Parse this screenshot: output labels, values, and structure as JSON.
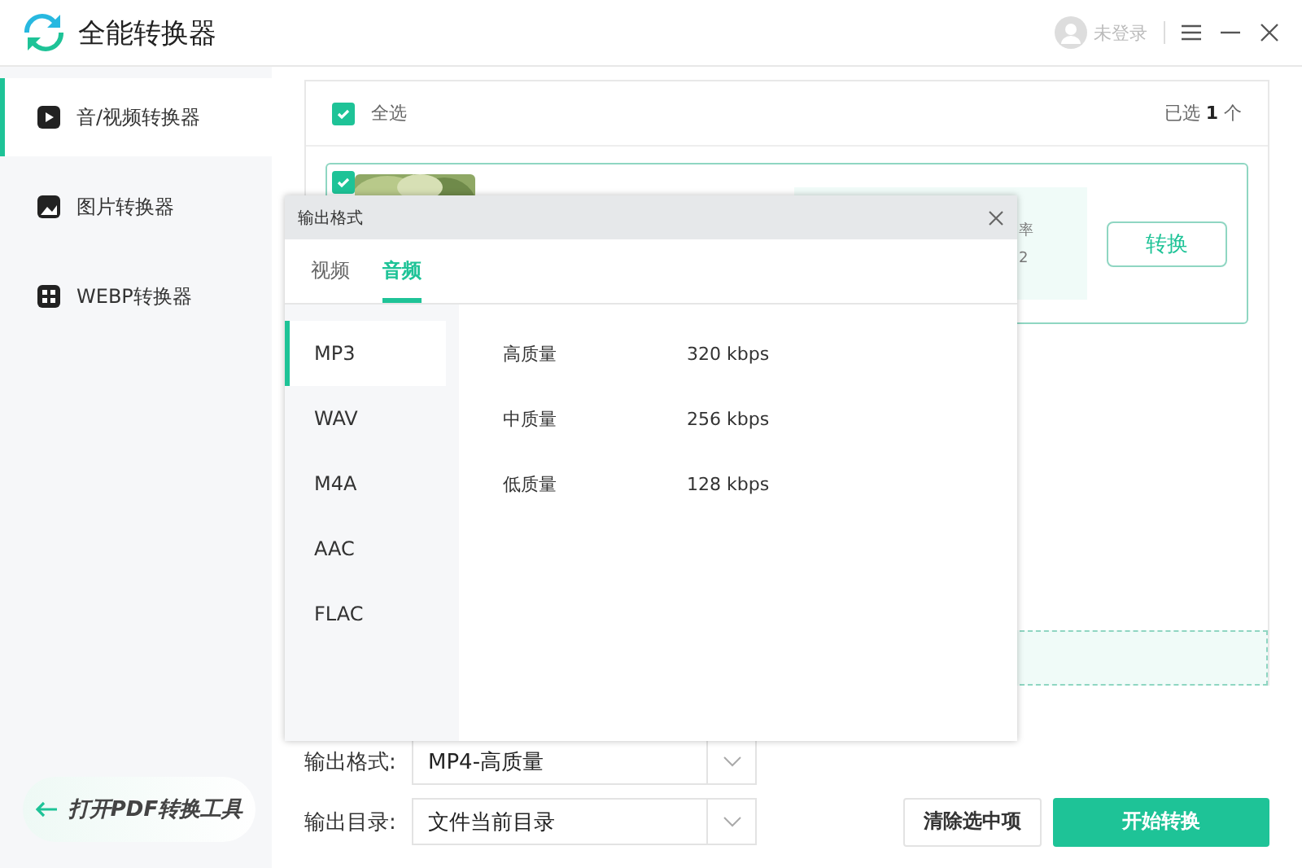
{
  "app": {
    "title": "全能转换器"
  },
  "user": {
    "label": "未登录"
  },
  "sidebar": {
    "items": [
      {
        "label": "音/视频转换器",
        "selected": true
      },
      {
        "label": "图片转换器",
        "selected": false
      },
      {
        "label": "WEBP转换器",
        "selected": false
      }
    ],
    "pdf_link": "打开PDF转换工具"
  },
  "file_list": {
    "select_all": {
      "label": "全选",
      "checked": true
    },
    "selected_count_prefix": "已选",
    "selected_count": "1",
    "selected_count_suffix": "个",
    "files": [
      {
        "checked": true,
        "thumbnail": {
          "kind": "picture"
        },
        "info_fragments": [
          "率",
          "2"
        ],
        "convert_button": "转换"
      }
    ]
  },
  "output": {
    "format_label": "输出格式:",
    "format_value": "MP4-高质量",
    "dir_label": "输出目录:",
    "dir_value": "文件当前目录"
  },
  "buttons": {
    "clear": "清除选中项",
    "start": "开始转换"
  },
  "dialog": {
    "title": "输出格式",
    "tabs": [
      {
        "label": "视频",
        "selected": false
      },
      {
        "label": "音频",
        "selected": true
      }
    ],
    "formats": [
      {
        "label": "MP3",
        "selected": true
      },
      {
        "label": "WAV",
        "selected": false
      },
      {
        "label": "M4A",
        "selected": false
      },
      {
        "label": "AAC",
        "selected": false
      },
      {
        "label": "FLAC",
        "selected": false
      }
    ],
    "qualities": [
      {
        "label": "高质量",
        "bitrate": "320 kbps"
      },
      {
        "label": "中质量",
        "bitrate": "256 kbps"
      },
      {
        "label": "低质量",
        "bitrate": "128 kbps"
      }
    ]
  }
}
